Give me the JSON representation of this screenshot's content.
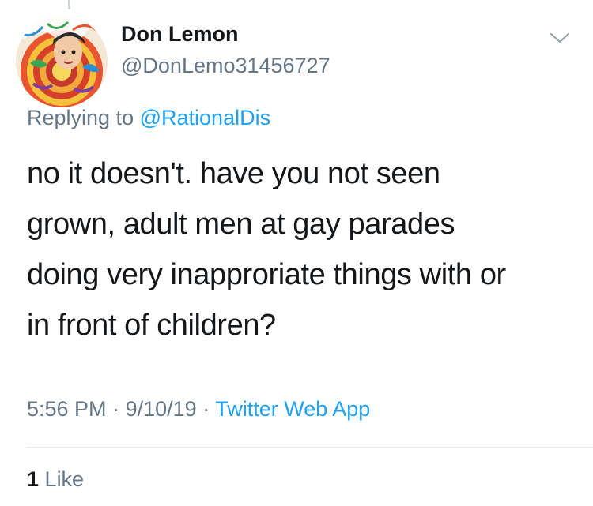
{
  "colors": {
    "text": "#14171a",
    "secondary": "#657786",
    "link": "#1da1f2",
    "divider": "#e1e8ed"
  },
  "author": {
    "name": "Don Lemon",
    "handle": "@DonLemo31456727",
    "avatar_icon": "avatar-image"
  },
  "reply": {
    "prefix": "Replying to",
    "mention": "@RationalDis"
  },
  "tweet": {
    "lines": [
      "no it doesn't. have you not seen",
      "grown, adult men at gay parades",
      "doing very inapproriate things with or",
      "in front of children?"
    ]
  },
  "meta": {
    "time": "5:56 PM",
    "separator": "·",
    "date": "9/10/19",
    "source": "Twitter Web App"
  },
  "stats": {
    "like_count": "1",
    "like_label": "Like"
  },
  "icons": {
    "menu": "chevron-down-icon"
  }
}
